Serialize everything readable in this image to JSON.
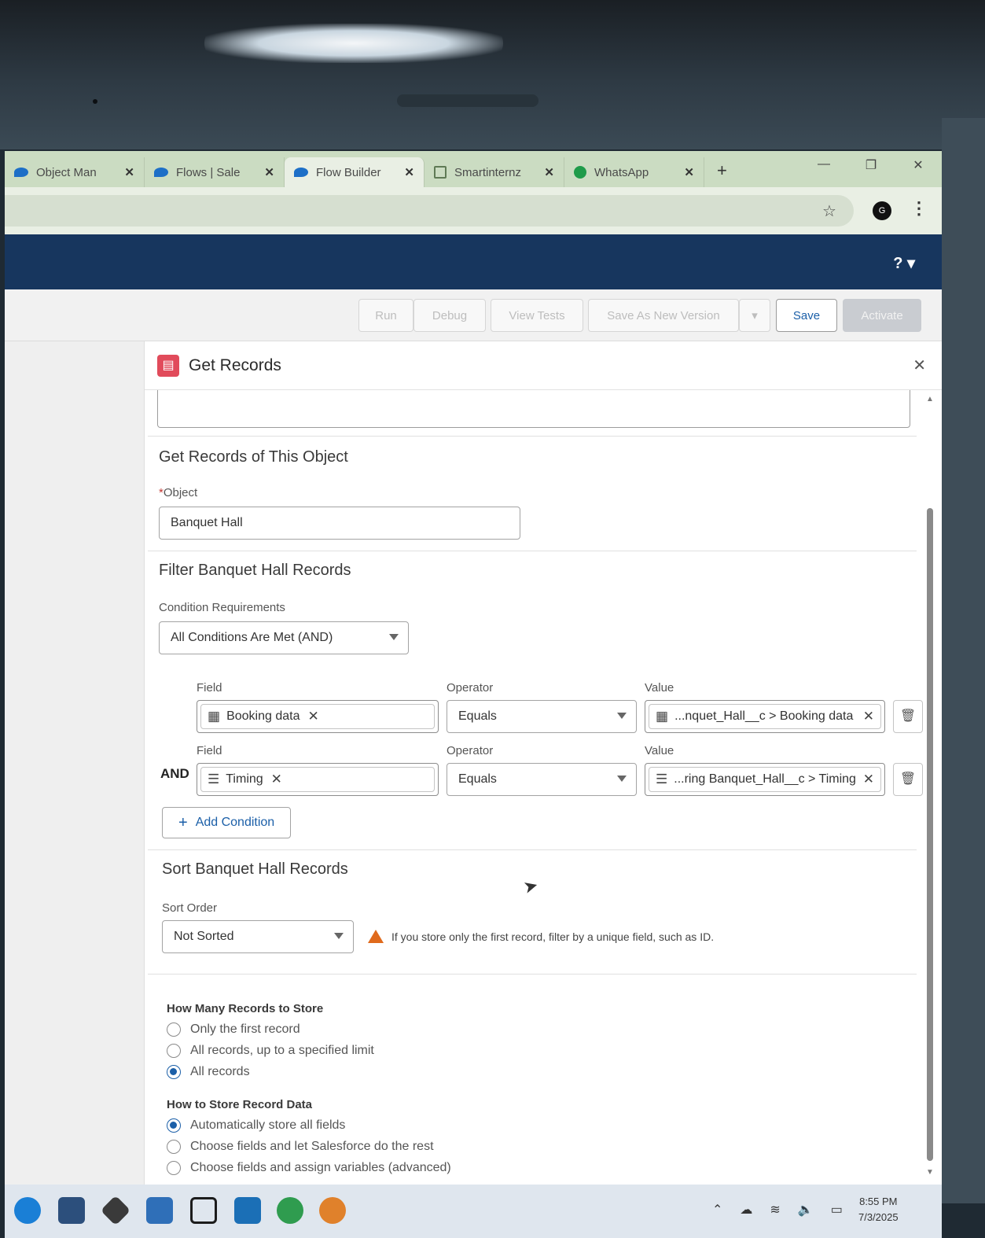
{
  "browser": {
    "tabs": [
      {
        "title": "Object Man",
        "icon": "salesforce-cloud-icon",
        "active": false
      },
      {
        "title": "Flows | Sale",
        "icon": "salesforce-cloud-icon",
        "active": false
      },
      {
        "title": "Flow Builder",
        "icon": "salesforce-cloud-icon",
        "active": true
      },
      {
        "title": "Smartinternz",
        "icon": "smartinternz-icon",
        "active": false
      },
      {
        "title": "WhatsApp",
        "icon": "whatsapp-icon",
        "active": false
      }
    ],
    "new_tab": "+",
    "profile_initial": "G"
  },
  "header": {
    "help": "? ▾"
  },
  "toolbar": {
    "run": "Run",
    "debug": "Debug",
    "view_tests": "View Tests",
    "save_as_new_version": "Save As New Version",
    "save": "Save",
    "activate": "Activate"
  },
  "panel": {
    "title": "Get Records",
    "object_section": {
      "title": "Get Records of This Object",
      "object_label": "Object",
      "object_value": "Banquet Hall"
    },
    "filter_section": {
      "title": "Filter Banquet Hall Records",
      "condition_label": "Condition Requirements",
      "condition_value": "All Conditions Are Met (AND)",
      "conditions": [
        {
          "prefix": "",
          "field_label": "Field",
          "field_value": "Booking data",
          "field_icon": "calendar-icon",
          "operator_label": "Operator",
          "operator_value": "Equals",
          "value_label": "Value",
          "value_value": "...nquet_Hall__c > Booking data",
          "value_icon": "calendar-icon"
        },
        {
          "prefix": "AND",
          "field_label": "Field",
          "field_value": "Timing",
          "field_icon": "picklist-icon",
          "operator_label": "Operator",
          "operator_value": "Equals",
          "value_label": "Value",
          "value_value": "...ring Banquet_Hall__c > Timing",
          "value_icon": "picklist-icon"
        }
      ],
      "add_condition": "Add Condition"
    },
    "sort_section": {
      "title": "Sort Banquet Hall Records",
      "sort_label": "Sort Order",
      "sort_value": "Not Sorted",
      "warning": "If you store only the first record, filter by a unique field, such as ID."
    },
    "store_count": {
      "title": "How Many Records to Store",
      "options": [
        "Only the first record",
        "All records, up to a specified limit",
        "All records"
      ],
      "selected": 2
    },
    "store_how": {
      "title": "How to Store Record Data",
      "options": [
        "Automatically store all fields",
        "Choose fields and let Salesforce do the rest",
        "Choose fields and assign variables (advanced)"
      ],
      "selected": 0
    }
  },
  "taskbar": {
    "time": "8:55 PM",
    "date": "7/3/2025"
  },
  "colors": {
    "salesforce_header": "#17365e",
    "link_blue": "#1b5fa8",
    "record_icon": "#e14b5b",
    "warning": "#e06a1c"
  }
}
